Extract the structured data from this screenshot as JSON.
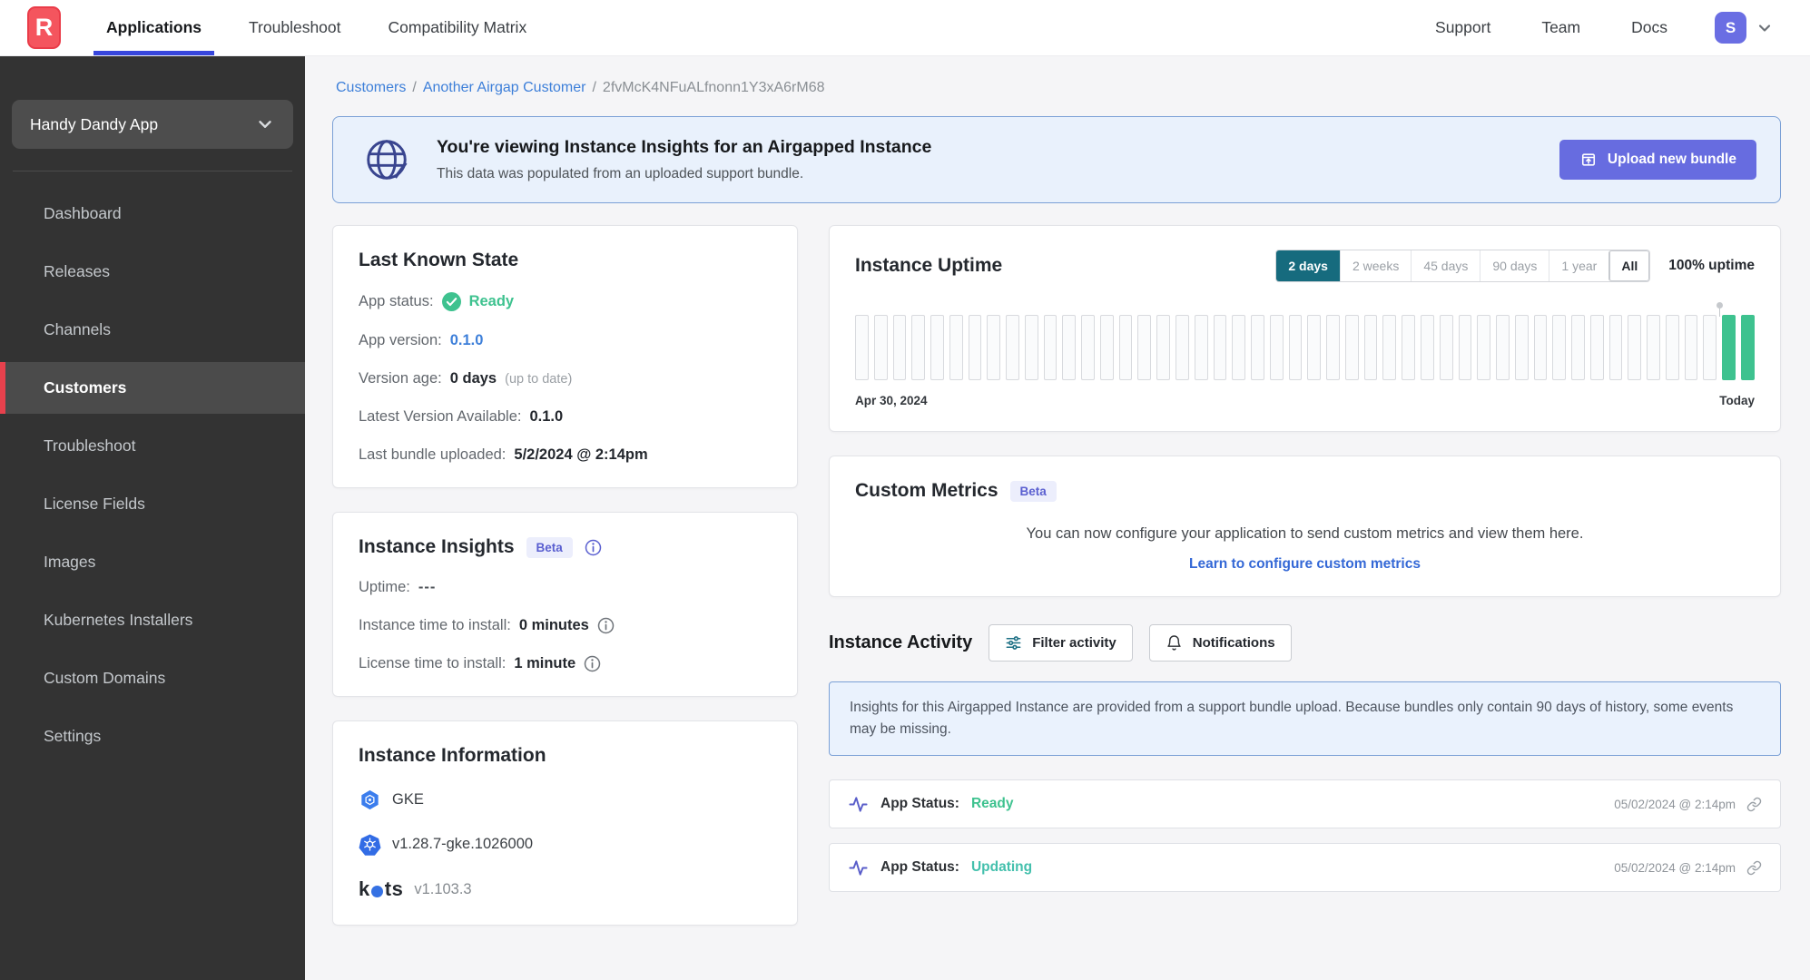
{
  "colors": {
    "accent_blue": "#3746dd",
    "brand_red": "#f4555e",
    "periwinkle": "#676ce0",
    "teal_active": "#166b7e",
    "green": "#3ec28f",
    "teal_value": "#44c0ad",
    "link_blue": "#3d7fd9",
    "purple": "#5a5fd0",
    "sidebar_bg": "#333333",
    "active_item_red": "#e8414d"
  },
  "topnav": {
    "logo_letter": "R",
    "items": [
      {
        "label": "Applications",
        "active": true
      },
      {
        "label": "Troubleshoot",
        "active": false
      },
      {
        "label": "Compatibility Matrix",
        "active": false
      }
    ],
    "links": [
      "Support",
      "Team",
      "Docs"
    ],
    "avatar_initial": "S"
  },
  "sidebar": {
    "app_selector_label": "Handy Dandy App",
    "items": [
      {
        "label": "Dashboard",
        "active": false
      },
      {
        "label": "Releases",
        "active": false
      },
      {
        "label": "Channels",
        "active": false
      },
      {
        "label": "Customers",
        "active": true
      },
      {
        "label": "Troubleshoot",
        "active": false
      },
      {
        "label": "License Fields",
        "active": false
      },
      {
        "label": "Images",
        "active": false
      },
      {
        "label": "Kubernetes Installers",
        "active": false
      },
      {
        "label": "Custom Domains",
        "active": false
      },
      {
        "label": "Settings",
        "active": false
      }
    ]
  },
  "breadcrumb": [
    {
      "label": "Customers",
      "link": true
    },
    {
      "label": "Another Airgap Customer",
      "link": true
    },
    {
      "label": "2fvMcK4NFuALfnonn1Y3xA6rM68",
      "link": false
    }
  ],
  "banner": {
    "title": "You're viewing Instance Insights for an Airgapped Instance",
    "subtitle": "This data was populated from an uploaded support bundle.",
    "button_label": "Upload new bundle"
  },
  "last_known_state": {
    "title": "Last Known State",
    "rows": [
      {
        "label": "App status:",
        "value": "Ready",
        "type": "status"
      },
      {
        "label": "App version:",
        "value": "0.1.0",
        "type": "link"
      },
      {
        "label": "Version age:",
        "value": "0 days",
        "suffix": "(up to date)",
        "type": "bold"
      },
      {
        "label": "Latest Version Available:",
        "value": "0.1.0",
        "type": "bold"
      },
      {
        "label": "Last bundle uploaded:",
        "value": "5/2/2024 @ 2:14pm",
        "type": "bold"
      }
    ]
  },
  "instance_insights": {
    "title": "Instance Insights",
    "beta_label": "Beta",
    "rows": [
      {
        "label": "Uptime:",
        "value": "---",
        "type": "plain",
        "info": false
      },
      {
        "label": "Instance time to install:",
        "value": "0 minutes",
        "type": "bold",
        "info": true
      },
      {
        "label": "License time to install:",
        "value": "1 minute",
        "type": "bold",
        "info": true
      }
    ]
  },
  "instance_information": {
    "title": "Instance Information",
    "rows": [
      {
        "icon": "gke-icon",
        "text": "GKE"
      },
      {
        "icon": "kubernetes-icon",
        "text": "v1.28.7-gke.1026000"
      },
      {
        "icon": "kots-logo",
        "brand_prefix": "k",
        "brand_suffix": "ts",
        "text": "v1.103.3"
      }
    ]
  },
  "uptime_card": {
    "title": "Instance Uptime",
    "ranges": [
      "2 days",
      "2 weeks",
      "45 days",
      "90 days",
      "1 year",
      "All"
    ],
    "active_range": "2 days",
    "uptime_label": "100% uptime",
    "start_label": "Apr 30, 2024",
    "end_label": "Today"
  },
  "chart_data": {
    "type": "bar",
    "title": "Instance Uptime",
    "selected_range": "2 days",
    "summary": "100% uptime",
    "x_start": "Apr 30, 2024",
    "x_end": "Today",
    "bar_count": 48,
    "no_data_bar_count": 46,
    "data_bars": [
      {
        "index": 46,
        "value": 100
      },
      {
        "index": 47,
        "value": 100
      }
    ],
    "marker_bar_index": 46
  },
  "custom_metrics": {
    "title": "Custom Metrics",
    "beta_label": "Beta",
    "body": "You can now configure your application to send custom metrics and view them here.",
    "link_label": "Learn to configure custom metrics"
  },
  "activity": {
    "title": "Instance Activity",
    "filter_button_label": "Filter activity",
    "notifications_button_label": "Notifications",
    "notice": "Insights for this Airgapped Instance are provided from a support bundle upload. Because bundles only contain 90 days of history, some events may be missing.",
    "rows": [
      {
        "label": "App Status:",
        "value": "Ready",
        "value_color": "#3ec28f",
        "timestamp": "05/02/2024 @ 2:14pm"
      },
      {
        "label": "App Status:",
        "value": "Updating",
        "value_color": "#44c0ad",
        "timestamp": "05/02/2024 @ 2:14pm"
      }
    ]
  }
}
